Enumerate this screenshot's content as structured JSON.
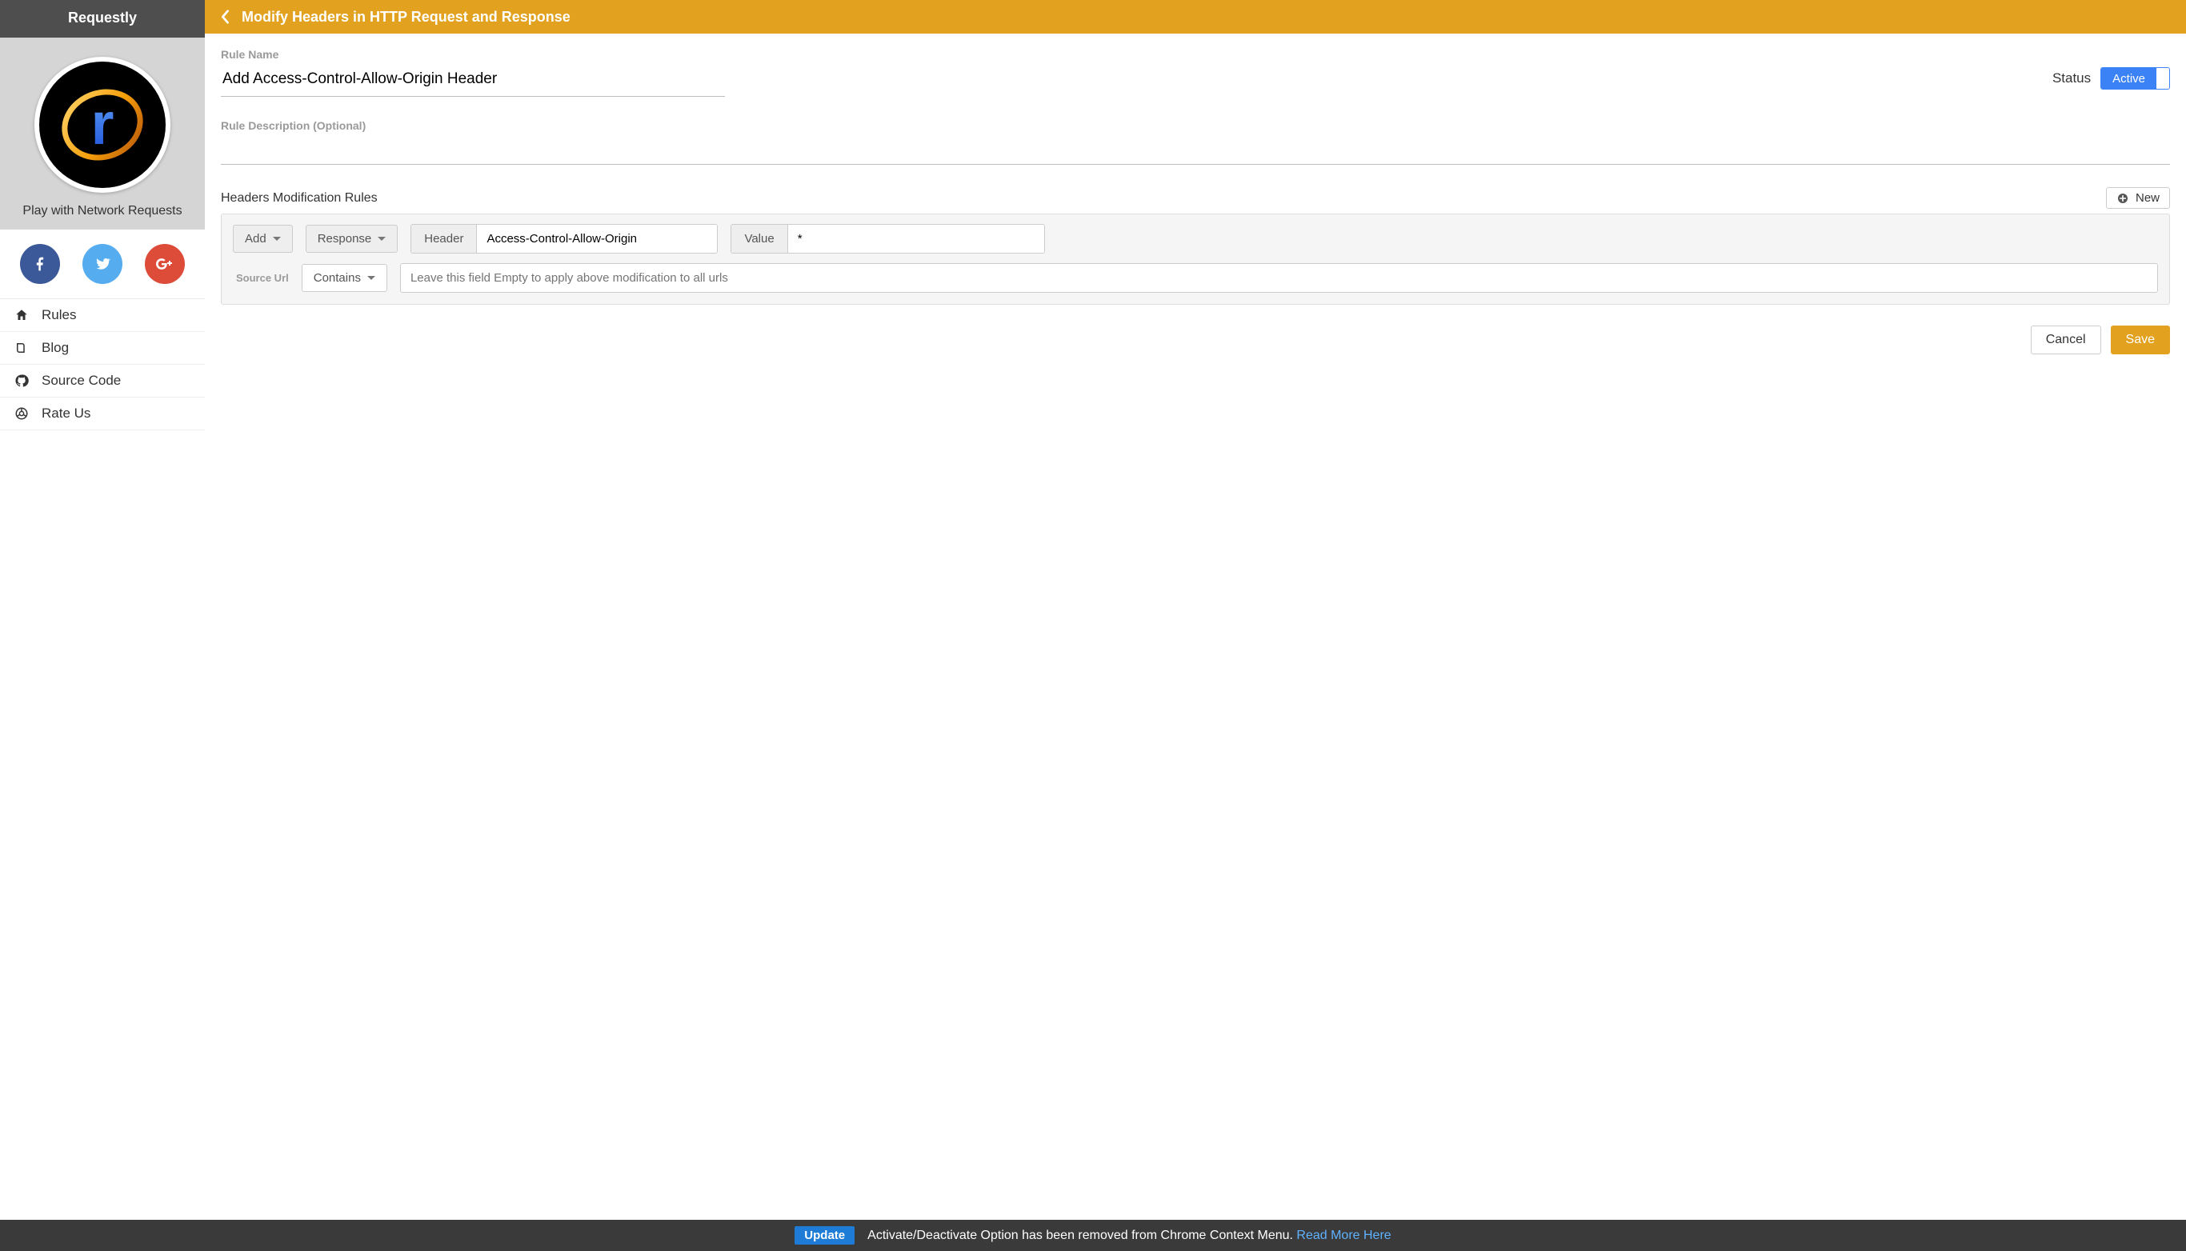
{
  "sidebar": {
    "brand": "Requestly",
    "tagline": "Play with Network Requests",
    "social": {
      "facebook": "f",
      "twitter": "t",
      "google_plus": "g+"
    },
    "nav": [
      {
        "icon": "home-icon",
        "label": "Rules"
      },
      {
        "icon": "book-icon",
        "label": "Blog"
      },
      {
        "icon": "github-icon",
        "label": "Source Code"
      },
      {
        "icon": "chrome-icon",
        "label": "Rate Us"
      }
    ]
  },
  "topbar": {
    "title": "Modify Headers in HTTP Request and Response"
  },
  "form": {
    "rule_name_label": "Rule Name",
    "rule_name_value": "Add Access-Control-Allow-Origin Header",
    "status_label": "Status",
    "status_value": "Active",
    "rule_desc_label": "Rule Description (Optional)",
    "rule_desc_value": ""
  },
  "rules_section": {
    "title": "Headers Modification Rules",
    "new_button": "New",
    "rule": {
      "action_dropdown": "Add",
      "target_dropdown": "Response",
      "header_addon": "Header",
      "header_value": "Access-Control-Allow-Origin",
      "value_addon": "Value",
      "value_value": "*",
      "source_label": "Source Url",
      "match_dropdown": "Contains",
      "url_placeholder": "Leave this field Empty to apply above modification to all urls",
      "url_value": ""
    }
  },
  "actions": {
    "cancel": "Cancel",
    "save": "Save"
  },
  "banner": {
    "badge": "Update",
    "text": "Activate/Deactivate Option has been removed from Chrome Context Menu.",
    "link": "Read More Here"
  }
}
